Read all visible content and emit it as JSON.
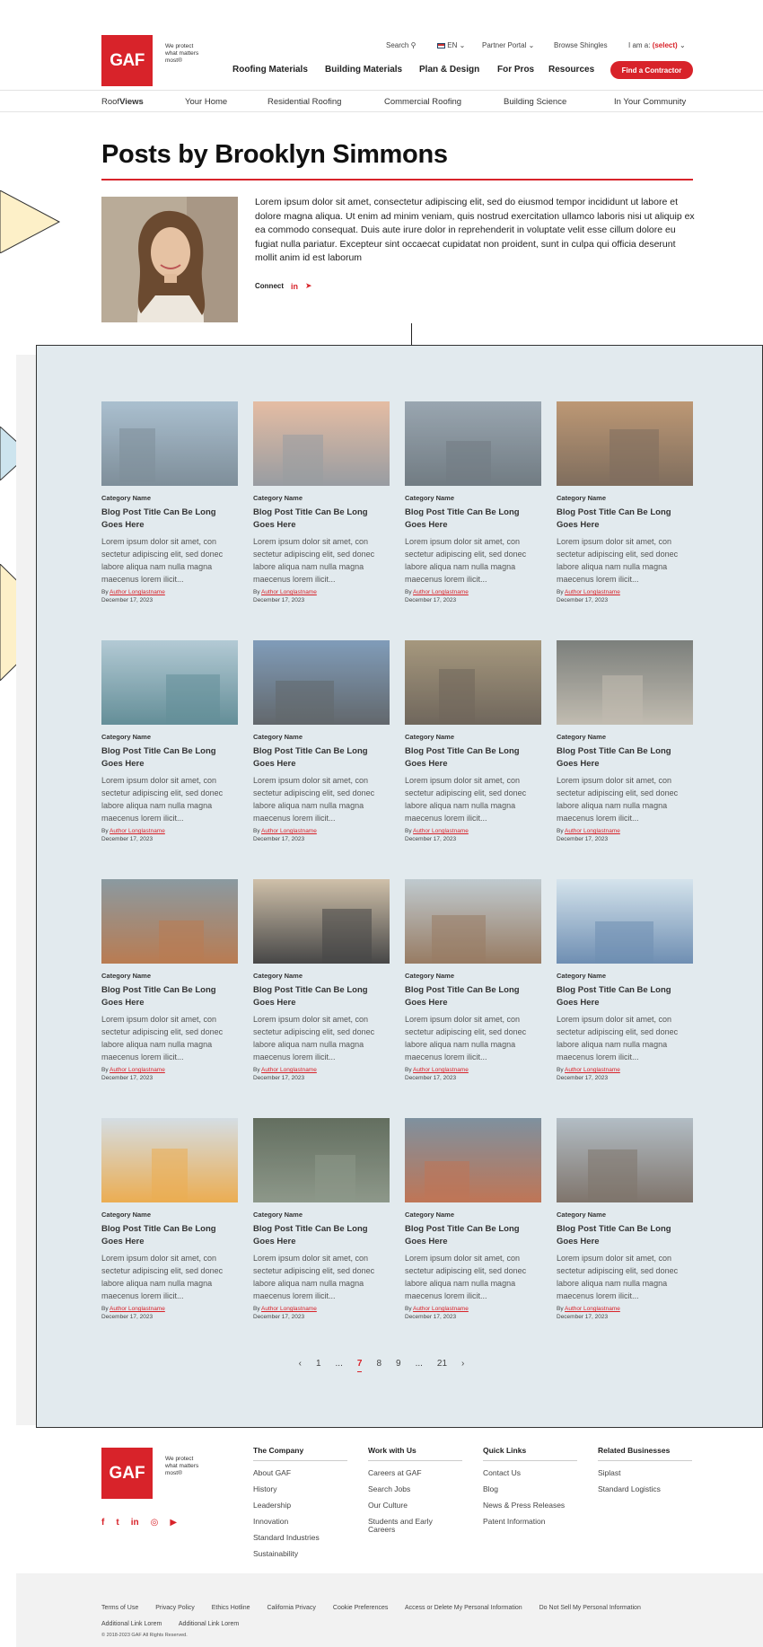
{
  "header": {
    "logo_text": "GAF",
    "tagline": "We protect what matters most®",
    "utility": {
      "search": "Search",
      "language": "EN",
      "partner_portal": "Partner Portal",
      "browse_shingles": "Browse Shingles",
      "i_am_label": "I am a:",
      "i_am_value": "(select)"
    },
    "nav": [
      "Roofing Materials",
      "Building Materials",
      "Plan & Design",
      "For Pros",
      "Resources"
    ],
    "cta": "Find a Contractor"
  },
  "subnav": {
    "brand_prefix": "Roof",
    "brand_suffix": "Views",
    "items": [
      "Your Home",
      "Residential Roofing",
      "Commercial Roofing",
      "Building Science",
      "In Your Community"
    ]
  },
  "page": {
    "title": "Posts by Brooklyn Simmons",
    "bio": "Lorem ipsum dolor sit amet, consectetur adipiscing elit, sed do eiusmod tempor incididunt ut labore et dolore magna aliqua. Ut enim ad minim veniam, quis nostrud exercitation ullamco laboris nisi ut aliquip ex ea commodo consequat. Duis aute irure dolor in reprehenderit in voluptate velit esse cillum dolore eu fugiat nulla pariatur. Excepteur sint occaecat cupidatat non proident, sunt in culpa qui officia deserunt mollit anim id est laborum",
    "connect_label": "Connect",
    "connect_icons": [
      "in",
      "t"
    ]
  },
  "card_template": {
    "category": "Category Name",
    "title": "Blog Post Title Can Be Long Goes Here",
    "excerpt": "Lorem ipsum dolor sit amet, con sectetur adipiscing elit, sed donec labore aliqua nam nulla magna maecenus lorem ilicit...",
    "by_label": "By",
    "author": "Author Longlastname",
    "date": "December 17, 2023"
  },
  "pagination": {
    "prev": "‹",
    "pages": [
      "1",
      "...",
      "7",
      "8",
      "9",
      "...",
      "21"
    ],
    "active": "7",
    "next": "›"
  },
  "footer": {
    "logo_text": "GAF",
    "tagline": "We protect what matters most®",
    "social": [
      "f",
      "t",
      "in",
      "◎",
      "▶"
    ],
    "columns": [
      {
        "heading": "The Company",
        "links": [
          "About GAF",
          "History",
          "Leadership",
          "Innovation",
          "Standard Industries",
          "Sustainability"
        ]
      },
      {
        "heading": "Work with Us",
        "links": [
          "Careers at GAF",
          "Search Jobs",
          "Our Culture",
          "Students and Early Careers"
        ]
      },
      {
        "heading": "Quick Links",
        "links": [
          "Contact Us",
          "Blog",
          "News & Press Releases",
          "Patent Information"
        ]
      },
      {
        "heading": "Related Businesses",
        "links": [
          "Siplast",
          "Standard Logistics"
        ]
      }
    ],
    "legal": [
      "Terms of Use",
      "Privacy Policy",
      "Ethics Hotline",
      "California Privacy",
      "Cookie Preferences",
      "Access or Delete My Personal Information",
      "Do Not Sell My Personal Information",
      "Additional Link Lorem",
      "Additional Link Lorem"
    ],
    "copyright": "© 2018-2023 GAF All Rights Reserved."
  },
  "colors": {
    "brand_red": "#d8232a",
    "panel_bg": "#e2eaee",
    "callout_yellow": "#fdf0c8",
    "callout_blue": "#cde4ee"
  }
}
